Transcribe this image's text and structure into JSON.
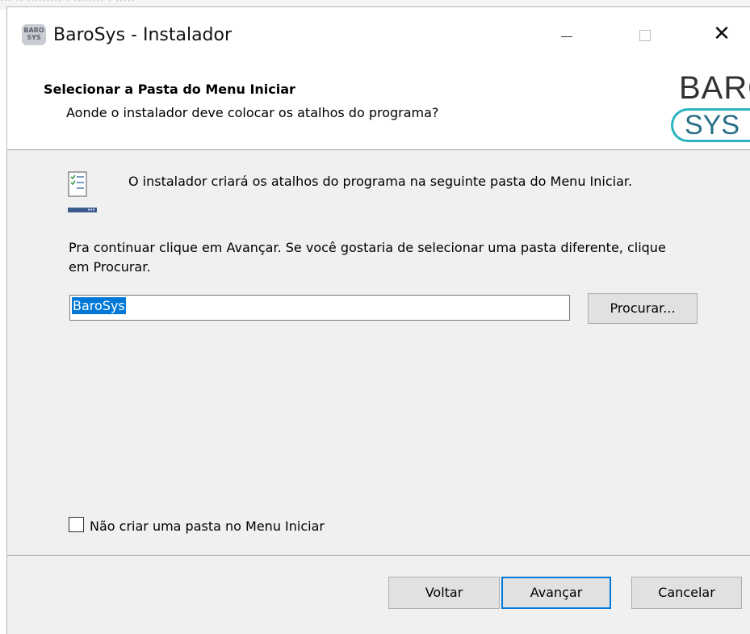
{
  "window": {
    "title": "BaroSys - Instalador",
    "app_icon_text": "BARO SYS"
  },
  "header": {
    "title": "Selecionar a Pasta do Menu Iniciar",
    "subtitle": "Aonde o instalador deve colocar os atalhos do programa?",
    "logo_top": "BARO",
    "logo_bottom": "SYS",
    "logo_color": "#2bb3c0"
  },
  "body": {
    "info_text": "O instalador criará os atalhos do programa na seguinte pasta do Menu Iniciar.",
    "instruction_text": "Pra continuar clique em Avançar. Se você gostaria de selecionar uma pasta diferente, clique em Procurar.",
    "folder_value": "BaroSys",
    "browse_label": "Procurar...",
    "checkbox_label": "Não criar uma pasta no Menu Iniciar",
    "checkbox_checked": false
  },
  "footer": {
    "back_label": "Voltar",
    "next_label": "Avançar",
    "cancel_label": "Cancelar"
  },
  "colors": {
    "accent": "#0078d7",
    "dialog_bg": "#f0f0f0",
    "button_bg": "#e1e1e1"
  },
  "icons": [
    "app-icon",
    "minimize-icon",
    "maximize-icon",
    "close-icon",
    "start-menu-folder-icon"
  ]
}
